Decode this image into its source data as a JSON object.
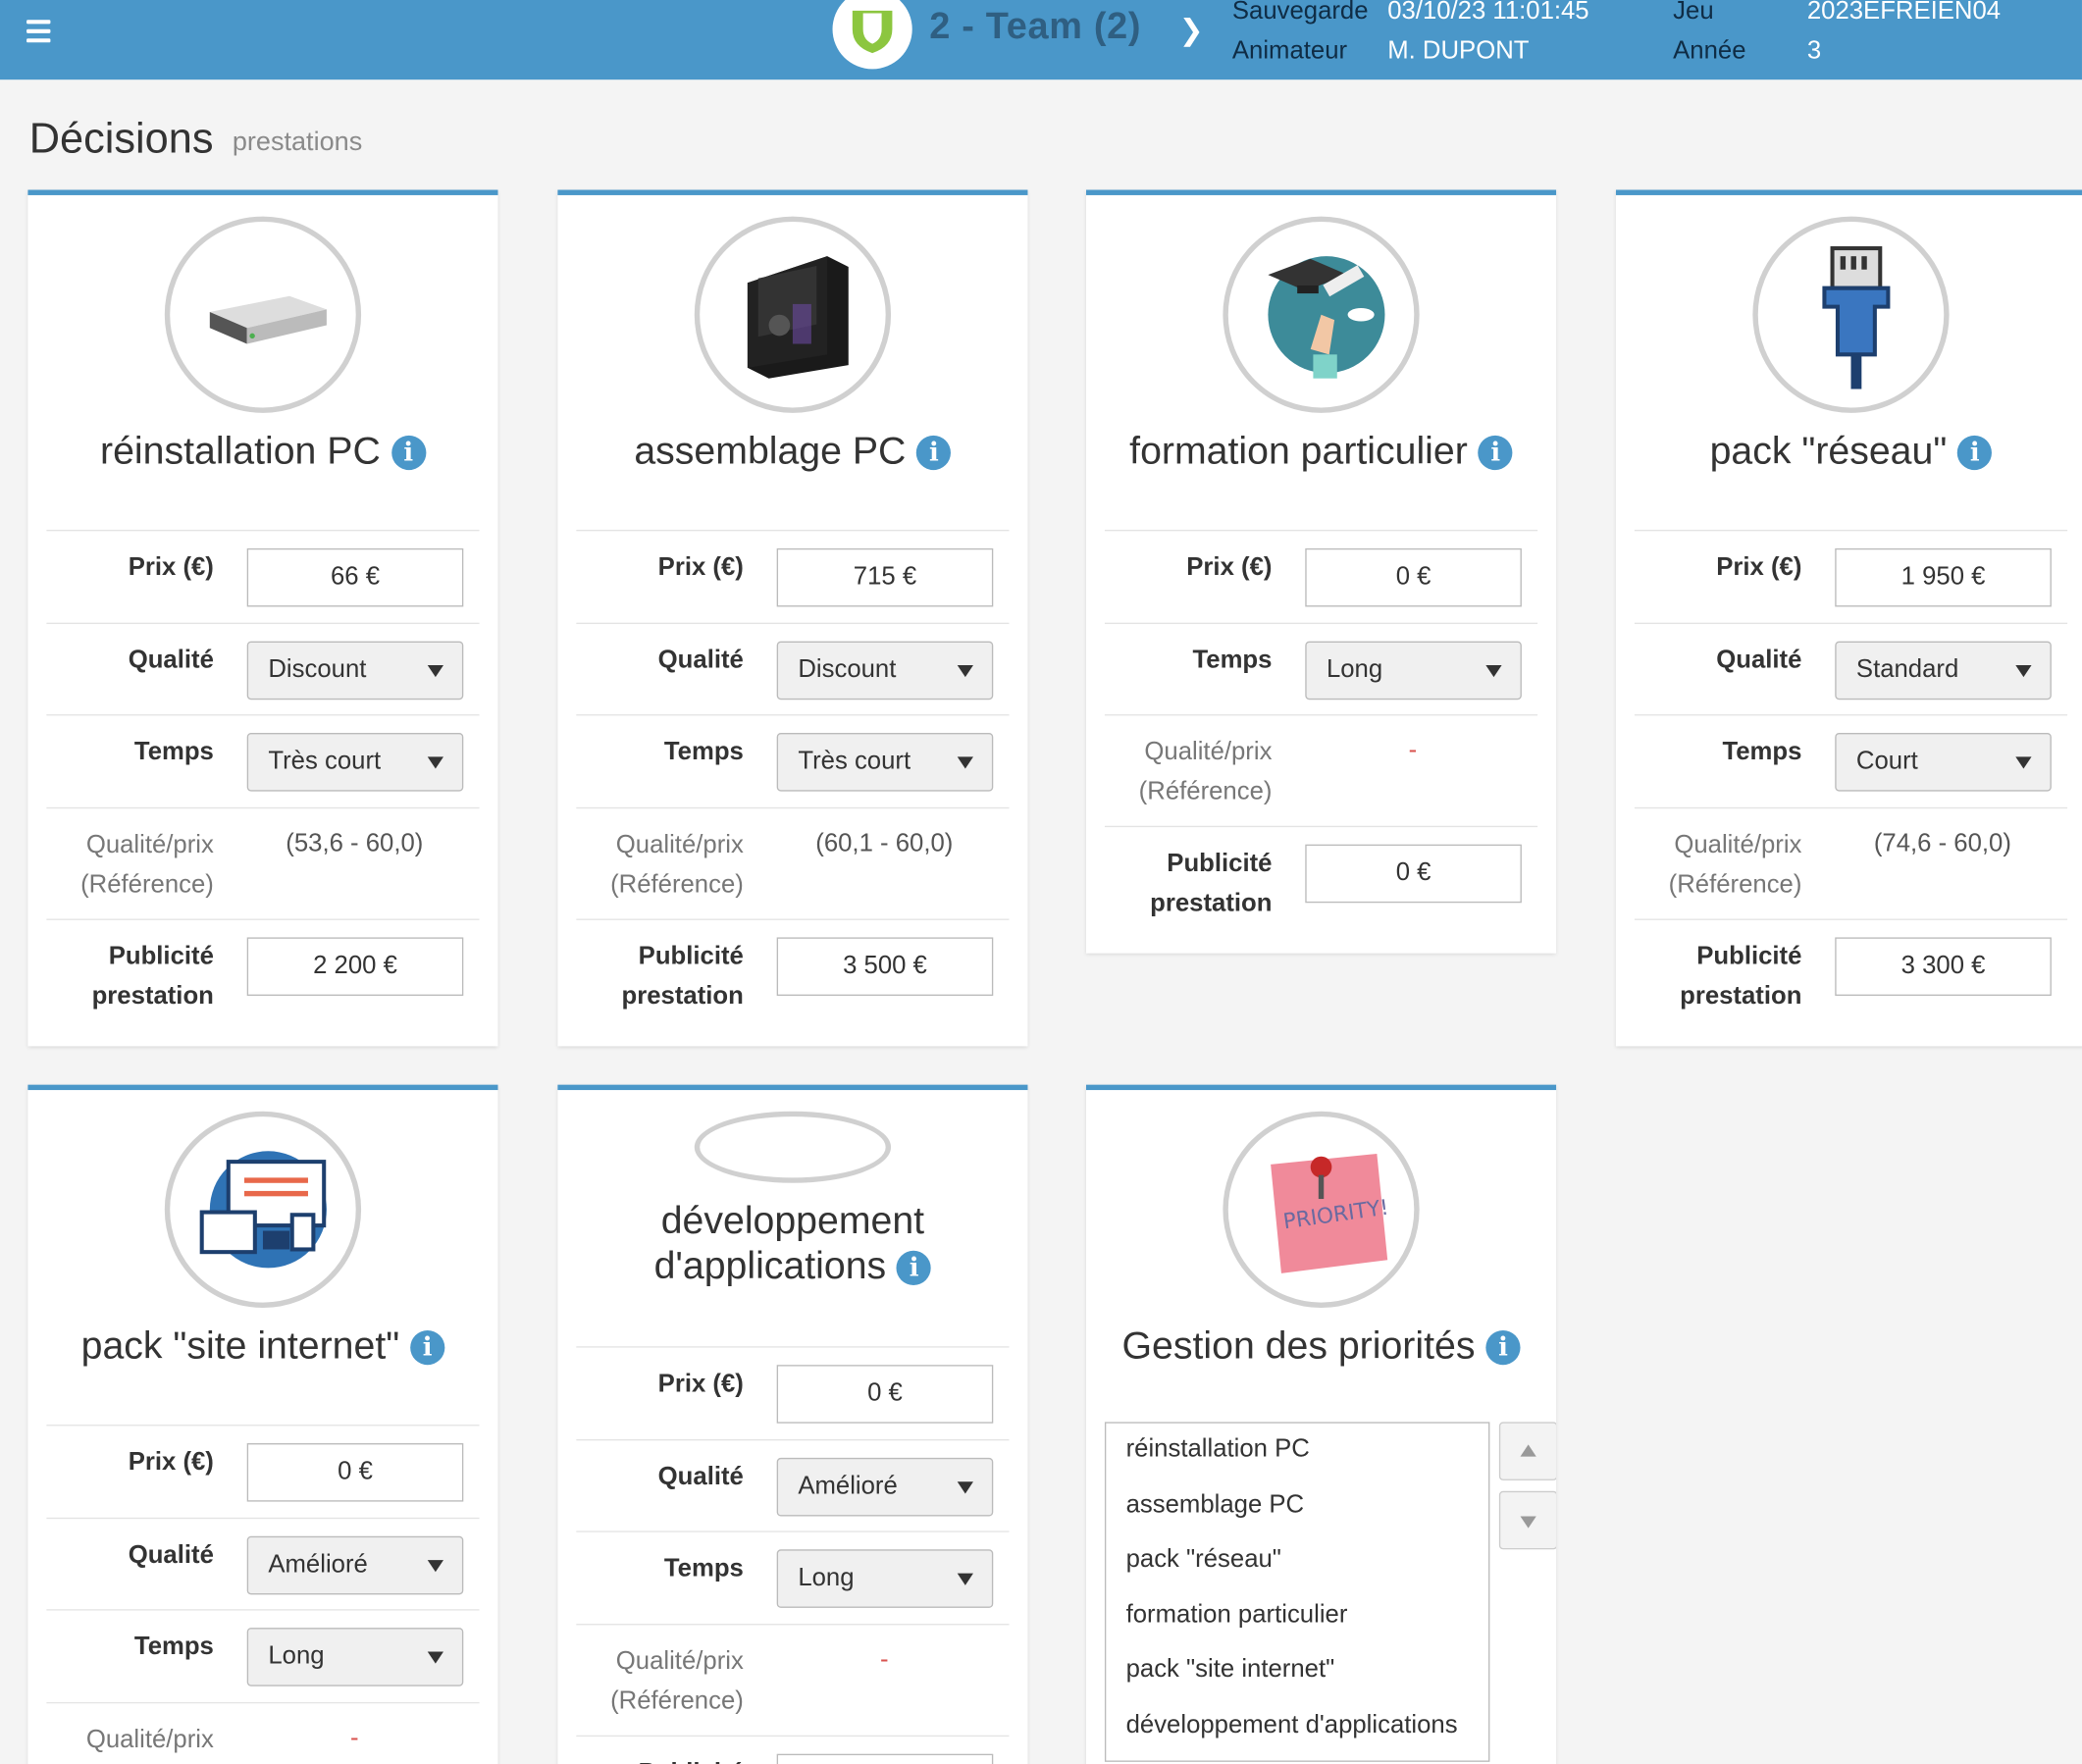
{
  "header": {
    "team": "2 - Team (2)",
    "save_label": "Sauvegarde",
    "save_value": "03/10/23 11:01:45",
    "animator_label": "Animateur",
    "animator_value": "M. DUPONT",
    "game_label": "Jeu",
    "game_value": "2023EFREIEN04",
    "year_label": "Année",
    "year_value": "3"
  },
  "page": {
    "title": "Décisions",
    "subtitle": "prestations"
  },
  "labels": {
    "price": "Prix (€)",
    "quality": "Qualité",
    "time": "Temps",
    "qp1": "Qualité/prix",
    "qp2": "(Référence)",
    "pub1": "Publicité",
    "pub2": "prestation"
  },
  "cards": [
    {
      "title": "réinstallation PC",
      "price": "66 €",
      "quality": "Discount",
      "time": "Très court",
      "qp": "(53,6 - 60,0)",
      "pub": "2 200 €",
      "icon": "hard-drive-icon"
    },
    {
      "title": "assemblage PC",
      "price": "715 €",
      "quality": "Discount",
      "time": "Très court",
      "qp": "(60,1 - 60,0)",
      "pub": "3 500 €",
      "icon": "pc-tower-icon"
    },
    {
      "title": "formation particulier",
      "price": "0 €",
      "time": "Long",
      "qp": "-",
      "pub": "0 €",
      "icon": "graduation-icon"
    },
    {
      "title": "pack \"réseau\"",
      "price": "1 950 €",
      "quality": "Standard",
      "time": "Court",
      "qp": "(74,6 - 60,0)",
      "pub": "3 300 €",
      "icon": "network-cable-icon"
    },
    {
      "title": "pack \"site internet\"",
      "price": "0 €",
      "quality": "Amélioré",
      "time": "Long",
      "qp": "-",
      "icon": "website-devices-icon"
    },
    {
      "title1": "développement",
      "title2": "d'applications",
      "price": "0 €",
      "quality": "Amélioré",
      "time": "Long",
      "qp": "-",
      "icon": "app-dev-icon"
    },
    {
      "title": "Gestion des priorités",
      "icon": "priority-note-icon"
    }
  ],
  "priorities": [
    "réinstallation PC",
    "assemblage PC",
    "pack \"réseau\"",
    "formation particulier",
    "pack \"site internet\"",
    "développement d'applications"
  ],
  "colors": {
    "accent": "#4a97c9",
    "header_text_dark": "#2f5f82",
    "dash": "#d9534f"
  }
}
